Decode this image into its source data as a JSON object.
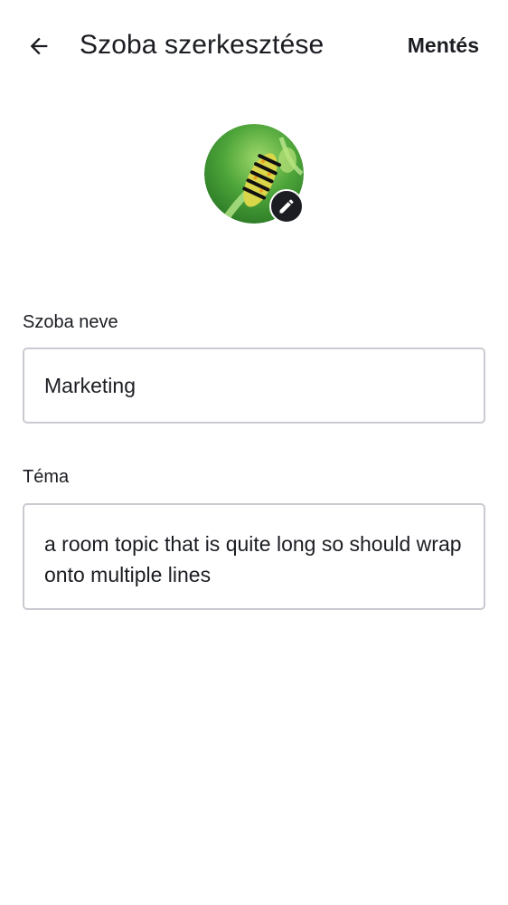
{
  "header": {
    "title": "Szoba szerkesztése",
    "save_label": "Mentés",
    "back_icon": "arrow-left-icon"
  },
  "avatar": {
    "image_subject": "caterpillar on green plant",
    "edit_icon": "pencil-icon"
  },
  "form": {
    "name_label": "Szoba neve",
    "name_value": "Marketing",
    "topic_label": "Téma",
    "topic_value": "a room topic that is quite long so should wrap onto multiple lines"
  },
  "colors": {
    "text": "#1b1d22",
    "border": "#c9cbd0",
    "background": "#ffffff",
    "badge": "#1b1d22"
  }
}
